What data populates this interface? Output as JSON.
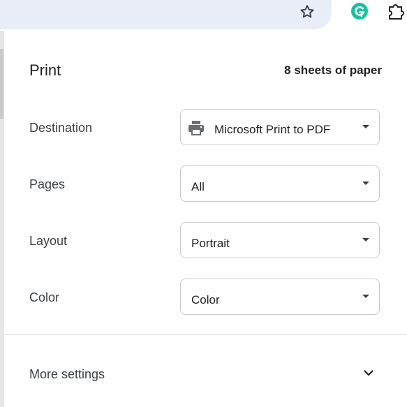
{
  "toolbar": {
    "bookmark_icon": "star-outline-icon",
    "grammarly_icon": "grammarly-icon",
    "extensions_icon": "puzzle-icon",
    "grammarly_color": "#15c39a"
  },
  "print": {
    "title": "Print",
    "sheets": "8 sheets of paper",
    "rows": [
      {
        "label": "Destination",
        "value": "Microsoft Print to PDF",
        "icon": "printer-icon"
      },
      {
        "label": "Pages",
        "value": "All"
      },
      {
        "label": "Layout",
        "value": "Portrait"
      },
      {
        "label": "Color",
        "value": "Color"
      }
    ],
    "more_settings": "More settings"
  }
}
